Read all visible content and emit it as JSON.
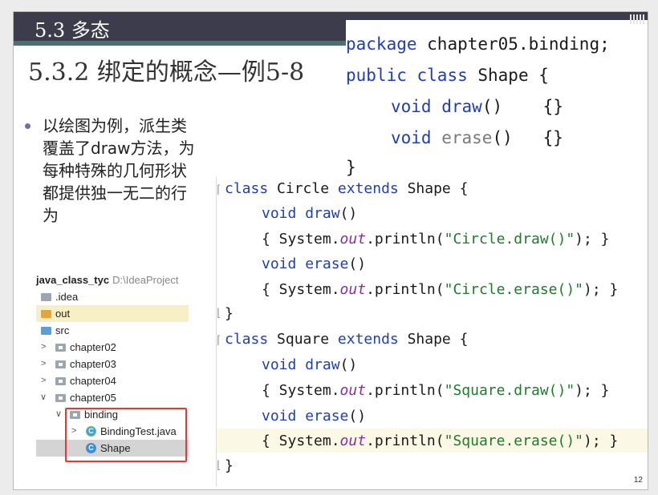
{
  "slide": {
    "section_title": "5.3 多态",
    "subtitle": "5.3.2 绑定的概念—例5-8",
    "bullet_text": "以绘图为例，派生类覆盖了draw方法，为每种特殊的几何形状都提供独一无二的行为",
    "page_number": "12"
  },
  "project_tree": {
    "root": {
      "name": "java_class_tyc",
      "path": "D:\\IdeaProject"
    },
    "items": [
      {
        "label": ".idea"
      },
      {
        "label": "out"
      },
      {
        "label": "src"
      },
      {
        "label": "chapter02"
      },
      {
        "label": "chapter03"
      },
      {
        "label": "chapter04"
      },
      {
        "label": "chapter05"
      },
      {
        "label": "binding"
      },
      {
        "label": "BindingTest.java"
      },
      {
        "label": "Shape"
      }
    ]
  },
  "code_top": {
    "line1": {
      "kw": "package",
      "rest": " chapter05.binding;"
    },
    "line2": {
      "kw1": "public",
      "kw2": "class",
      "rest": " Shape {"
    },
    "line3": {
      "kw": "void",
      "fn": "draw",
      "rest": "()    {}"
    },
    "line4": {
      "kw": "void",
      "fn": "erase",
      "rest": "()   {}"
    },
    "line5": "}"
  },
  "code_main": {
    "c1": {
      "kw": "class",
      "name": " Circle ",
      "kw2": "extends",
      "rest": " Shape {"
    },
    "c2": {
      "kw": "void",
      "fn": "draw",
      "rest": "()"
    },
    "c3": {
      "pre": "{ System.",
      "out": "out",
      "mid": ".println(",
      "str": "\"Circle.draw()\"",
      "end": "); }"
    },
    "c4": {
      "kw": "void",
      "fn": "erase",
      "rest": "()"
    },
    "c5": {
      "pre": "{ System.",
      "out": "out",
      "mid": ".println(",
      "str": "\"Circle.erase()\"",
      "end": "); }"
    },
    "c6": "}",
    "s1": {
      "kw": "class",
      "name": " Square ",
      "kw2": "extends",
      "rest": " Shape {"
    },
    "s2": {
      "kw": "void",
      "fn": "draw",
      "rest": "()"
    },
    "s3": {
      "pre": "{ System.",
      "out": "out",
      "mid": ".println(",
      "str": "\"Square.draw()\"",
      "end": "); }"
    },
    "s4": {
      "kw": "void",
      "fn": "erase",
      "rest": "()"
    },
    "s5": {
      "pre": "{ System.",
      "out": "out",
      "mid": ".println(",
      "str": "\"Square.erase()\"",
      "end": "); }"
    },
    "s6": "}"
  },
  "colors": {
    "title_bar": "#3c3c4c",
    "keyword": "#1f3fb0",
    "string": "#1f7a2c",
    "static_field": "#8a2ea0",
    "highlight_box": "#e53935"
  },
  "icons": [
    "folder-icon",
    "java-class-icon",
    "chevron-right-icon",
    "chevron-down-icon",
    "module-icon"
  ]
}
